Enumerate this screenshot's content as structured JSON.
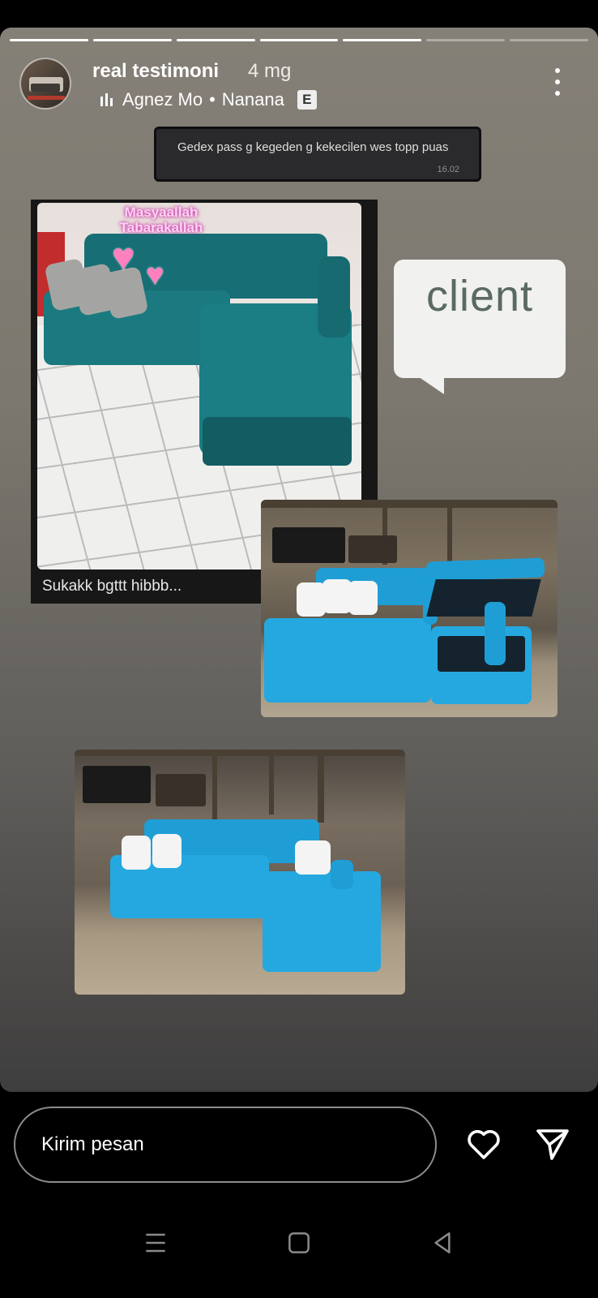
{
  "story": {
    "progress": {
      "total": 7,
      "viewed": 5
    },
    "username": "real testimoni",
    "time": "4 mg",
    "music": {
      "artist": "Agnez Mo",
      "separator": "•",
      "title": "Nanana",
      "explicit_badge": "E"
    },
    "menu_icon": "more-vertical-icon"
  },
  "chat_screenshot": {
    "message": "Gedex pass g kegeden g kekecilen wes topp puas",
    "timestamp": "16.02"
  },
  "photo1": {
    "overlay_text": "Masyaallah\nTabarakallah",
    "caption": "Sukakk  bgttt hibbb..."
  },
  "sticker": {
    "label": "client"
  },
  "reply_bar": {
    "placeholder": "Kirim pesan",
    "like_icon": "heart-icon",
    "send_icon": "send-icon"
  },
  "system_nav": {
    "icons": [
      "menu-icon",
      "home-square-icon",
      "back-triangle-icon"
    ]
  },
  "colors": {
    "sofa_dark_teal": "#1b7a80",
    "sofa_bright_blue": "#25a8e0",
    "accent_white": "#ffffff"
  }
}
